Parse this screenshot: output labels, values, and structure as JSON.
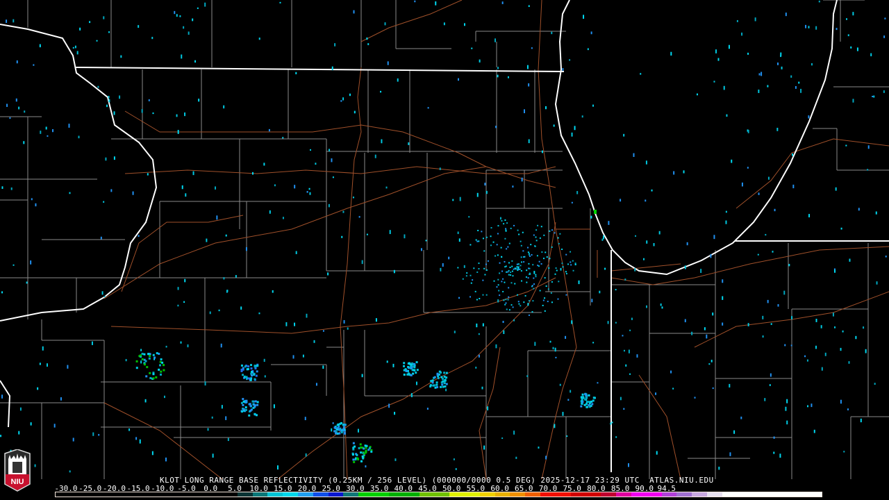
{
  "product": {
    "title": "KLOT LONG RANGE BASE REFLECTIVITY (0.25KM / 256 LEVEL) (000000/0000 0.5 DEG) 2025-12-17 23:29 UTC  ATLAS.NIU.EDU"
  },
  "legend": {
    "unit_values": [
      "-30.0",
      "-25.0",
      "-20.0",
      "-15.0",
      "-10.0",
      "-5.0",
      "0.0",
      "5.0",
      "10.0",
      "15.0",
      "20.0",
      "25.0",
      "30.0",
      "35.0",
      "40.0",
      "45.0",
      "50.0",
      "55.0",
      "60.0",
      "65.0",
      "70.0",
      "75.0",
      "80.0",
      "85.0",
      "90.0",
      "94.5"
    ],
    "color_stops": [
      {
        "from": 0,
        "color": "#0a3434"
      },
      {
        "from": 2.5,
        "color": "#0a7878"
      },
      {
        "from": 5,
        "color": "#00c4d4"
      },
      {
        "from": 7.5,
        "color": "#00d8ec"
      },
      {
        "from": 10,
        "color": "#20a0f0"
      },
      {
        "from": 12.5,
        "color": "#1050e8"
      },
      {
        "from": 15,
        "color": "#0818d0"
      },
      {
        "from": 17.5,
        "color": "#107878"
      },
      {
        "from": 20,
        "color": "#00d000"
      },
      {
        "from": 25,
        "color": "#00b000"
      },
      {
        "from": 30,
        "color": "#70c000"
      },
      {
        "from": 35,
        "color": "#e0f000"
      },
      {
        "from": 40,
        "color": "#f0d000"
      },
      {
        "from": 42.5,
        "color": "#e8b000"
      },
      {
        "from": 45,
        "color": "#f09000"
      },
      {
        "from": 47.5,
        "color": "#f06000"
      },
      {
        "from": 50,
        "color": "#f01000"
      },
      {
        "from": 55,
        "color": "#d00000"
      },
      {
        "from": 60,
        "color": "#c00030"
      },
      {
        "from": 62.5,
        "color": "#e000a0"
      },
      {
        "from": 65,
        "color": "#f000f0"
      },
      {
        "from": 70,
        "color": "#b040d8"
      },
      {
        "from": 72.5,
        "color": "#a070d0"
      },
      {
        "from": 75,
        "color": "#c8a8e0"
      },
      {
        "from": 77.5,
        "color": "#e8e0f0"
      },
      {
        "from": 80,
        "color": "#ffffff"
      }
    ],
    "range": [
      -30,
      94.5
    ]
  },
  "logo": {
    "text": "NIU"
  },
  "colors": {
    "state_border": "#ffffff",
    "county": "#8a8a8a",
    "highway": "#a0502a",
    "echo": "#00c8e0"
  }
}
